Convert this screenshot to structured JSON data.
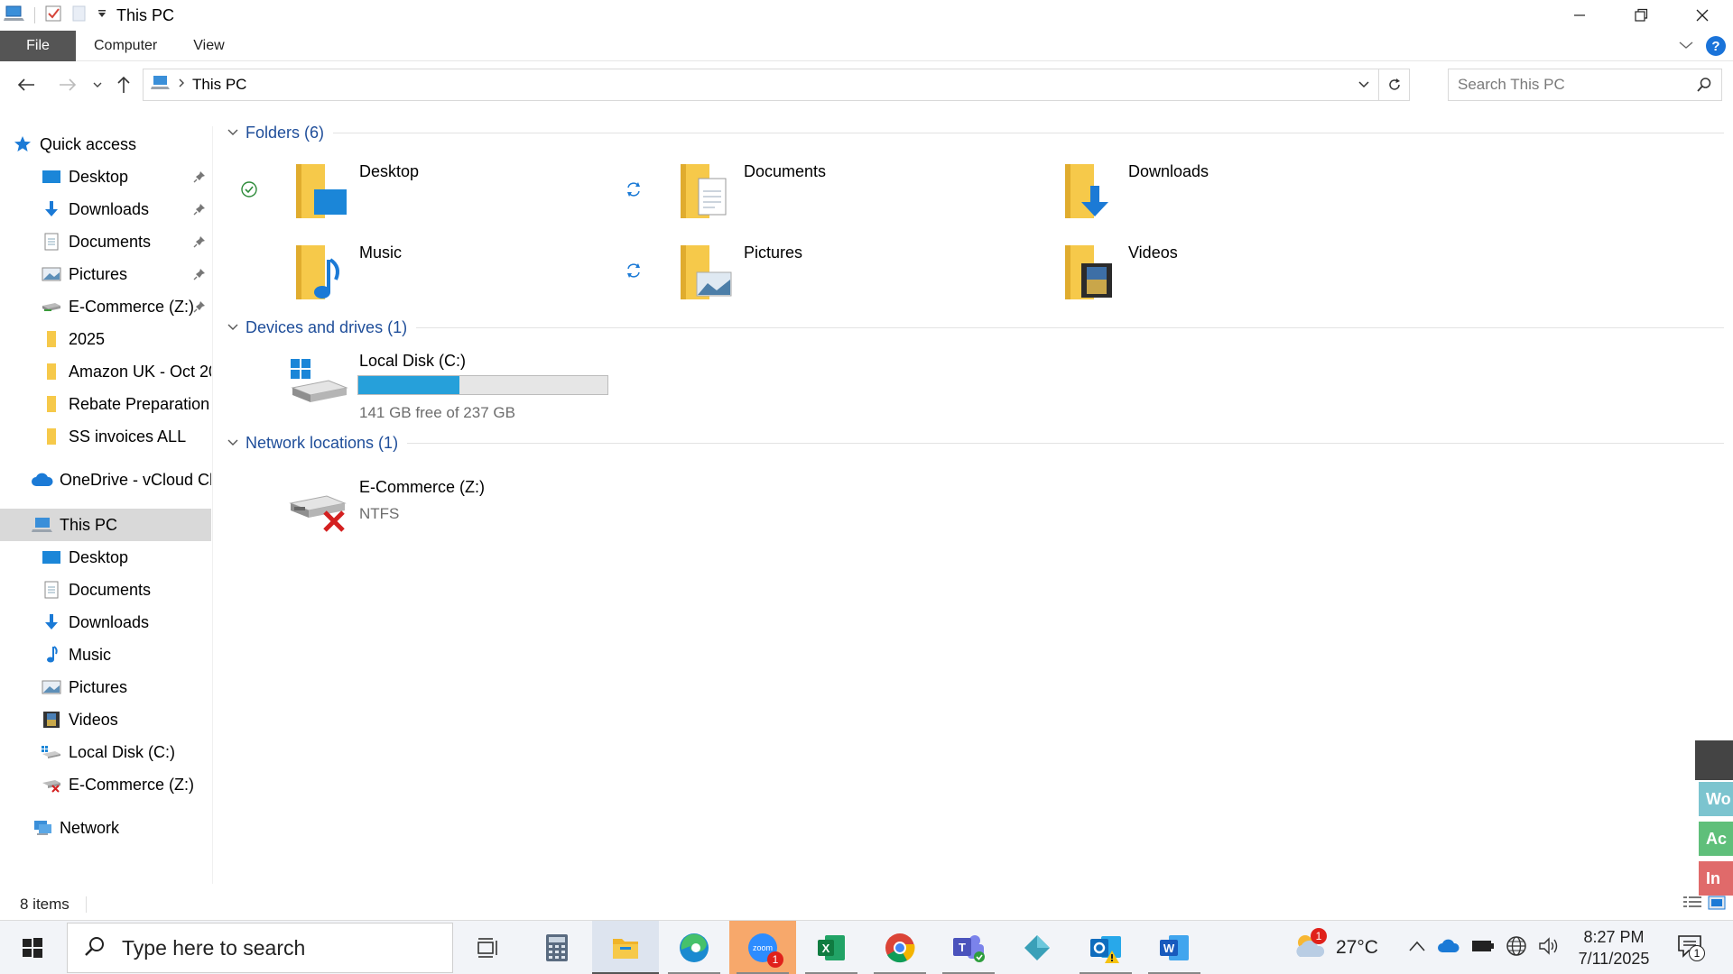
{
  "window": {
    "title": "This PC"
  },
  "ribbon": {
    "tabs": [
      "File",
      "Computer",
      "View"
    ]
  },
  "address": {
    "path": "This PC",
    "search_placeholder": "Search This PC"
  },
  "nav": {
    "quick_access": "Quick access",
    "quick_items": [
      "Desktop",
      "Downloads",
      "Documents",
      "Pictures",
      "E-Commerce (Z:)",
      "2025",
      "Amazon UK - Oct 20",
      "Rebate Preparation",
      "SS invoices ALL"
    ],
    "onedrive": "OneDrive - vCloud Ch",
    "this_pc": "This PC",
    "pc_items": [
      "Desktop",
      "Documents",
      "Downloads",
      "Music",
      "Pictures",
      "Videos",
      "Local Disk (C:)",
      "E-Commerce (Z:)"
    ],
    "network": "Network"
  },
  "groups": {
    "folders": "Folders (6)",
    "devices": "Devices and drives (1)",
    "network": "Network locations (1)"
  },
  "folders": [
    "Desktop",
    "Documents",
    "Downloads",
    "Music",
    "Pictures",
    "Videos"
  ],
  "drive": {
    "name": "Local Disk (C:)",
    "free": "141 GB free of 237 GB",
    "used_fraction": 0.405
  },
  "netloc": {
    "name": "E-Commerce (Z:)",
    "fs": "NTFS"
  },
  "status": {
    "count": "8 items"
  },
  "side_widget": [
    "Wo",
    "Ac",
    "In"
  ],
  "taskbar": {
    "search": "Type here to search",
    "zoom_badge": "1",
    "weather_badge": "1",
    "temp": "27°C",
    "time": "8:27 PM",
    "date": "7/11/2025",
    "notif": "1"
  },
  "colors": {
    "accent": "#26a0da",
    "folder": "#f6c94a",
    "selected": "#d9d9d9"
  }
}
